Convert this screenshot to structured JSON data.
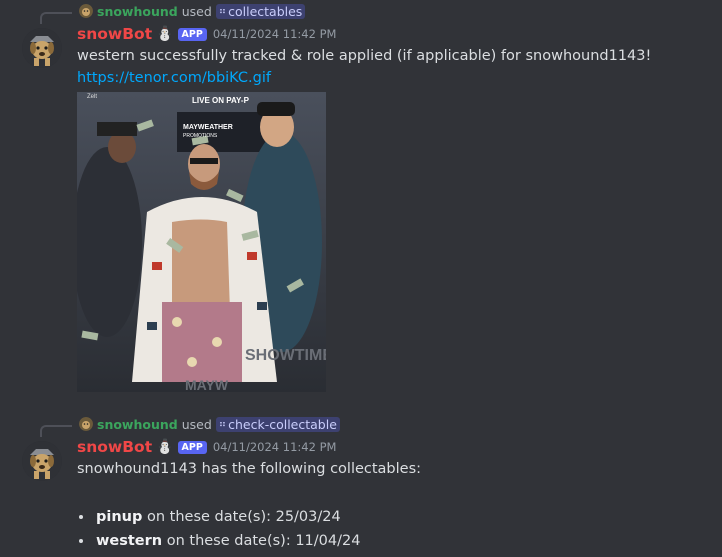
{
  "messages": [
    {
      "reply": {
        "user": "snowhound",
        "used": "used",
        "command": "collectables"
      },
      "author": "snowBot",
      "badge": "APP",
      "timestamp": "04/11/2024 11:42 PM",
      "text": "western successfully tracked & role applied (if applicable) for snowhound1143!",
      "link": "https://tenor.com/bbiKC.gif",
      "gif": {
        "top_text": "LIVE ON PAY-P",
        "banner": "MAYWEATHER",
        "banner2": "PROMOTIONS",
        "corner": "Zelt",
        "bottom_a": "SHOWTIME",
        "bottom_b": "MAYW"
      }
    },
    {
      "reply": {
        "user": "snowhound",
        "used": "used",
        "command": "check-collectable"
      },
      "author": "snowBot",
      "badge": "APP",
      "timestamp": "04/11/2024 11:42 PM",
      "text": "snowhound1143 has the following collectables:",
      "items": [
        {
          "name": "pinup",
          "suffix": " on these date(s): 25/03/24"
        },
        {
          "name": "western",
          "suffix": " on these date(s): 11/04/24"
        }
      ]
    }
  ],
  "icons": {
    "avatar": "dog-avatar-icon",
    "bot_emoji": "snowman-icon",
    "command": "grid-icon"
  },
  "colors": {
    "background": "#313338",
    "author": "#f04747",
    "reply_user": "#3ba55d",
    "link": "#00a8fc",
    "badge": "#5865f2"
  }
}
